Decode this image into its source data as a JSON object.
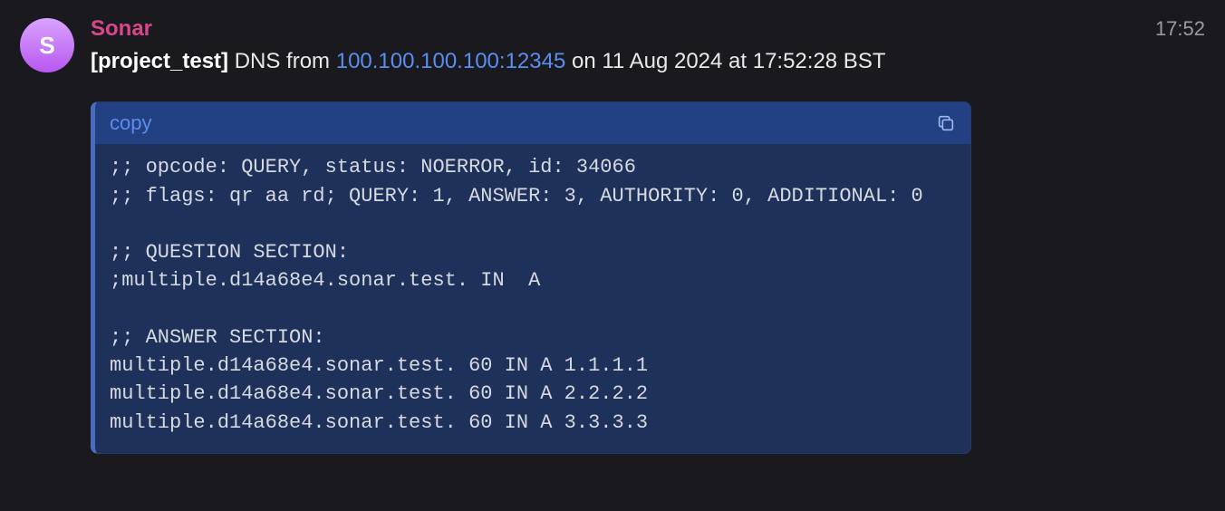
{
  "message": {
    "avatar_letter": "S",
    "author": "Sonar",
    "timestamp": "17:52",
    "subject": {
      "project_tag": "[project_test]",
      "prefix": " DNS from ",
      "link": "100.100.100.100:12345",
      "suffix": " on 11 Aug 2024 at 17:52:28 BST"
    },
    "code": {
      "copy_label": "copy",
      "body": ";; opcode: QUERY, status: NOERROR, id: 34066\n;; flags: qr aa rd; QUERY: 1, ANSWER: 3, AUTHORITY: 0, ADDITIONAL: 0\n\n;; QUESTION SECTION:\n;multiple.d14a68e4.sonar.test. IN  A\n\n;; ANSWER SECTION:\nmultiple.d14a68e4.sonar.test. 60 IN A 1.1.1.1\nmultiple.d14a68e4.sonar.test. 60 IN A 2.2.2.2\nmultiple.d14a68e4.sonar.test. 60 IN A 3.3.3.3"
    }
  }
}
